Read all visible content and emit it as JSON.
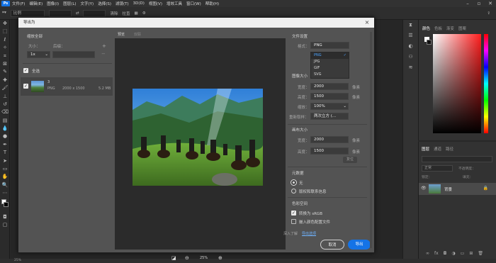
{
  "menubar": {
    "logo": "Ps",
    "items": [
      "文件(F)",
      "编辑(E)",
      "图像(I)",
      "图层(L)",
      "文字(Y)",
      "选择(S)",
      "滤镜(T)",
      "3D(D)",
      "视图(V)",
      "增效工具",
      "窗口(W)",
      "帮助(H)"
    ]
  },
  "optbar": {
    "ratio": "比例",
    "clear": "清除",
    "straighten": "拉直"
  },
  "right": {
    "color_tabs": [
      "颜色",
      "色板",
      "渐变",
      "图案"
    ],
    "layer_tabs": [
      "图层",
      "通道",
      "路径"
    ],
    "blend": "正常",
    "opacity": "不透明度：",
    "lock": "锁定：",
    "fill": "填充：",
    "layer_name": "背景"
  },
  "status": "25%",
  "dialog": {
    "title": "导出为",
    "zoom_all": "缩放全部",
    "size_label": "大小：",
    "suffix_label": "后缀：",
    "scale_value": "1x",
    "select_all": "全选",
    "asset": {
      "name": "3",
      "format": "PNG",
      "dims": "2000 x 1500",
      "size": "5.2 MB"
    },
    "tabs": {
      "preview": "预览",
      "compare": "双联"
    },
    "zoom_level": "25%",
    "file_settings": "文件设置",
    "format_label": "格式：",
    "format_value": "PNG",
    "format_options": [
      "PNG",
      "JPG",
      "GIF",
      "SVG"
    ],
    "image_size": "图像大小",
    "width_label": "宽度：",
    "width_value": "2000",
    "height_label": "高度：",
    "height_value": "1500",
    "scale_label": "缩放：",
    "scale_pct": "100%",
    "resample_label": "重新取样：",
    "resample_value": "两次立方 (...",
    "unit_px": "像素",
    "canvas_size": "画布大小",
    "canvas_width": "2000",
    "canvas_height": "1500",
    "reset": "复位",
    "metadata": "元数据",
    "meta_none": "无",
    "meta_copyright": "版权和联系信息",
    "color_space": "色彩空间",
    "convert_srgb": "转换为 sRGB",
    "embed_profile": "嵌入颜色配置文件",
    "learn_more": "深入了解",
    "export_prefs": "导出选项",
    "cancel": "取消",
    "export": "导出"
  },
  "colors": {
    "accent": "#1473e6",
    "dialog_bg": "#535353"
  }
}
